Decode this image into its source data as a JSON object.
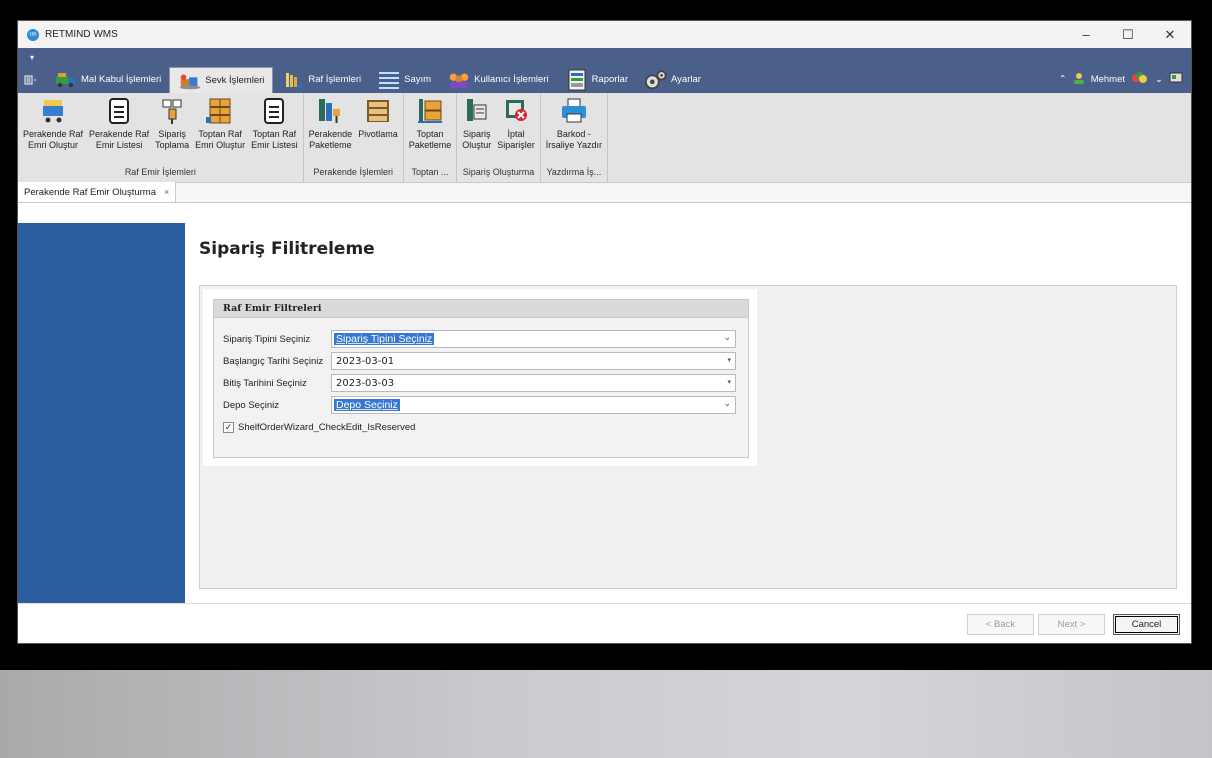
{
  "window": {
    "title": "RETMIND WMS",
    "logo_text": "rm",
    "controls": {
      "minimize": "–",
      "maximize": "☐",
      "close": "✕"
    }
  },
  "qat": {
    "menu_glyph": "▾"
  },
  "tabs": [
    {
      "label": "Mal Kabul İşlemleri",
      "icon": "truck-icon"
    },
    {
      "label": "Sevk İşlemleri",
      "icon": "shipment-icon",
      "active": true
    },
    {
      "label": "Raf İşlemleri",
      "icon": "shelf-icon"
    },
    {
      "label": "Sayım",
      "icon": "count-list-icon"
    },
    {
      "label": "Kullanıcı İşlemleri",
      "icon": "users-icon"
    },
    {
      "label": "Raporlar",
      "icon": "report-icon"
    },
    {
      "label": "Ayarlar",
      "icon": "gears-icon"
    }
  ],
  "user": {
    "name": "Mehmet"
  },
  "ribbon_groups": [
    {
      "label": "Raf Emir İşlemleri",
      "buttons": [
        {
          "label1": "Perakende Raf",
          "label2": "Emri Oluştur",
          "icon": "cart-icon"
        },
        {
          "label1": "Perakende Raf",
          "label2": "Emir Listesi",
          "icon": "document-list-icon"
        },
        {
          "label1": "Sipariş",
          "label2": "Toplama",
          "icon": "picking-icon"
        },
        {
          "label1": "Toptan Raf",
          "label2": "Emri Oluştur",
          "icon": "warehouse-shelf-icon"
        },
        {
          "label1": "Toptan Raf",
          "label2": "Emir Listesi",
          "icon": "document-list-icon"
        }
      ]
    },
    {
      "label": "Perakende İşlemleri",
      "buttons": [
        {
          "label1": "Perakende",
          "label2": "Paketleme",
          "icon": "packaging-icon"
        },
        {
          "label1": "Pivotlama",
          "label2": "",
          "icon": "pivot-shelf-icon"
        }
      ]
    },
    {
      "label": "Toptan ...",
      "buttons": [
        {
          "label1": "Toptan",
          "label2": "Paketleme",
          "icon": "wholesale-packaging-icon"
        }
      ]
    },
    {
      "label": "Sipariş Oluşturma",
      "buttons": [
        {
          "label1": "Sipariş",
          "label2": "Oluştur",
          "icon": "create-order-icon"
        },
        {
          "label1": "İptal",
          "label2": "Siparişler",
          "icon": "cancel-orders-icon"
        }
      ]
    },
    {
      "label": "Yazdırma İş...",
      "buttons": [
        {
          "label1": "Barkod -",
          "label2": "İrsaliye Yazdır",
          "icon": "printer-icon"
        }
      ]
    }
  ],
  "doc_tab": {
    "label": "Perakende Raf Emir Oluşturma",
    "close": "×"
  },
  "page": {
    "title": "Sipariş Filitreleme",
    "filter_box": {
      "header": "Raf Emir Filtreleri",
      "fields": [
        {
          "label": "Sipariş Tipini Seçiniz",
          "value": "Sipariş Tipini Seçiniz",
          "selected": true
        },
        {
          "label": "Başlangıç Tarihi Seçiniz",
          "value": "2023-03-01",
          "selected": false
        },
        {
          "label": "Bitiş Tarihini Seçiniz",
          "value": "2023-03-03",
          "selected": false
        },
        {
          "label": "Depo Seçiniz",
          "value": "Depo Seçiniz",
          "selected": true
        }
      ],
      "checkbox": {
        "label": "ShelfOrderWizard_CheckEdit_IsReserved",
        "checked": true
      }
    }
  },
  "footer": {
    "back": "< Back",
    "next": "Next >",
    "cancel": "Cancel"
  },
  "colors": {
    "ribbon_bar": "#4a5f8a",
    "left_panel": "#2a5e9f",
    "selection": "#3577d4"
  }
}
